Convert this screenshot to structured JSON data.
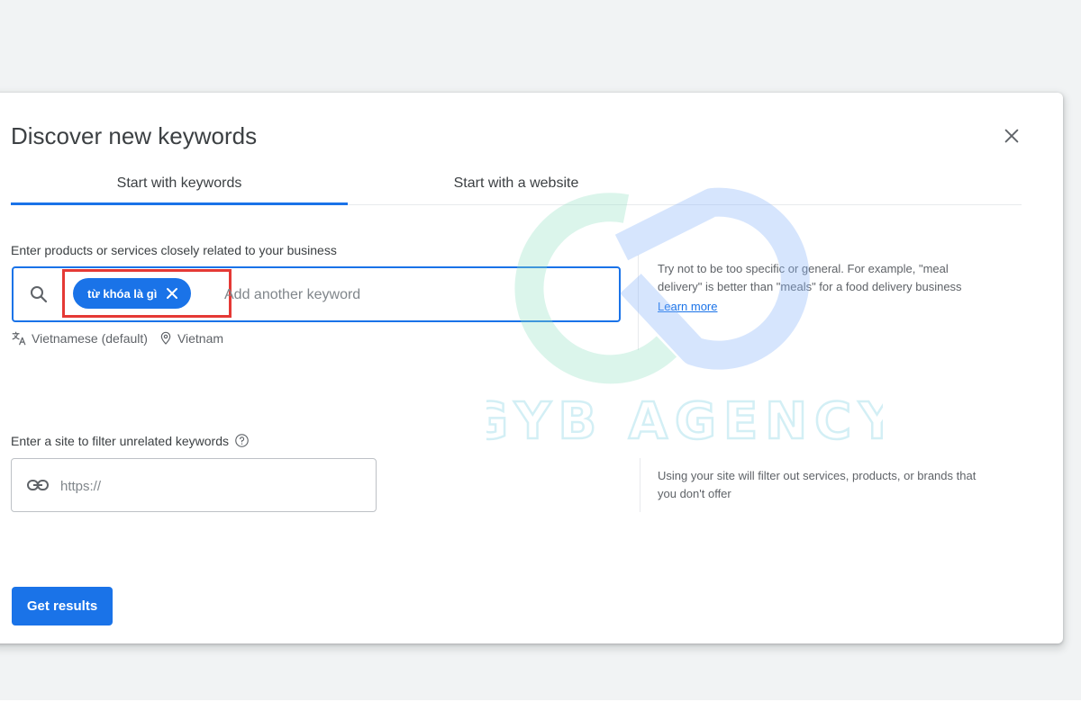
{
  "dialog": {
    "title": "Discover new keywords",
    "tabs": [
      {
        "label": "Start with keywords",
        "active": true
      },
      {
        "label": "Start with a website",
        "active": false
      }
    ]
  },
  "keywords": {
    "label": "Enter products or services closely related to your business",
    "chip": "từ khóa là gì",
    "placeholder": "Add another keyword",
    "language": "Vietnamese (default)",
    "location": "Vietnam",
    "hint": "Try not to be too specific or general. For example, \"meal delivery\" is better than \"meals\" for a food delivery business",
    "learn_more": "Learn more"
  },
  "site_filter": {
    "label": "Enter a site to filter unrelated keywords",
    "placeholder": "https://",
    "hint": "Using your site will filter out services, products, or brands that you don't offer"
  },
  "actions": {
    "get_results": "Get results"
  },
  "watermark": {
    "text": "GYB AGENCY"
  },
  "colors": {
    "accent": "#1a73e8",
    "highlight": "#e53935",
    "text": "#3c4043",
    "muted": "#5f6368"
  },
  "icons": [
    "close-icon",
    "search-icon",
    "chip-close-icon",
    "translate-icon",
    "location-pin-icon",
    "help-circle-icon",
    "link-icon"
  ]
}
